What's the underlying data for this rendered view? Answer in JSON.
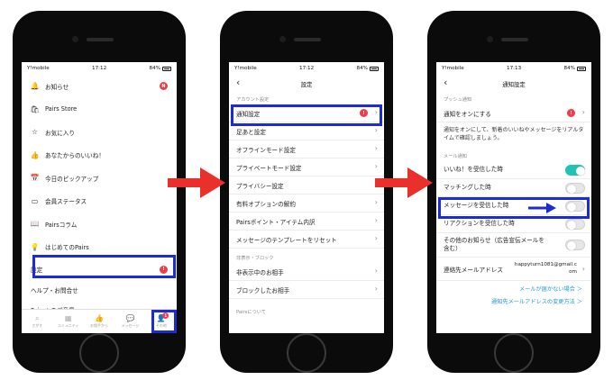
{
  "colors": {
    "accent_highlight": "#1d2bd6",
    "arrow": "#e9302a",
    "toggle_on": "#1fc4b4",
    "badge": "#ef3d49",
    "link": "#1b9ad6"
  },
  "phone1": {
    "status": {
      "carrier": "Y!mobile",
      "time": "17:12",
      "battery": "84%"
    },
    "menu": [
      {
        "icon": "bell-icon",
        "glyph": "🔔",
        "label": "お知らせ",
        "badge": "N"
      },
      {
        "icon": "store-icon",
        "glyph": "🛍",
        "label": "Pairs Store"
      },
      {
        "icon": "star-icon",
        "glyph": "☆",
        "label": "お気に入り"
      },
      {
        "icon": "thumbs-up-icon",
        "glyph": "👍",
        "label": "あなたからのいいね！"
      },
      {
        "icon": "calendar-icon",
        "glyph": "📅",
        "label": "今日のピックアップ"
      },
      {
        "icon": "card-icon",
        "glyph": "▭",
        "label": "会員ステータス"
      },
      {
        "icon": "book-icon",
        "glyph": "📖",
        "label": "Pairsコラム"
      },
      {
        "icon": "bulb-icon",
        "glyph": "💡",
        "label": "はじめてのPairs"
      }
    ],
    "settings": {
      "label": "設定",
      "badge": "!"
    },
    "extra": [
      "ヘルプ・お問合せ",
      "Pairsへのご意見"
    ],
    "tabs": [
      {
        "icon": "search-icon",
        "glyph": "⌕",
        "label": "さがす"
      },
      {
        "icon": "community-icon",
        "glyph": "▦",
        "label": "コミュニティ"
      },
      {
        "icon": "like-icon",
        "glyph": "👍",
        "label": "お相手から"
      },
      {
        "icon": "message-icon",
        "glyph": "💬",
        "label": "メッセージ"
      },
      {
        "icon": "person-icon",
        "glyph": "👤",
        "label": "その他",
        "badge": "1"
      }
    ]
  },
  "phone2": {
    "status": {
      "carrier": "Y!mobile",
      "time": "17:12",
      "battery": "84%"
    },
    "title": "設定",
    "section1": "アカウント設定",
    "rows1": [
      {
        "label": "通知設定",
        "badge": "!"
      },
      {
        "label": "足あと設定"
      },
      {
        "label": "オフラインモード設定"
      },
      {
        "label": "プライベートモード設定"
      },
      {
        "label": "プライバシー設定"
      },
      {
        "label": "有料オプションの解約"
      },
      {
        "label": "Pairsポイント・アイテム内訳"
      },
      {
        "label": "メッセージのテンプレートをリセット"
      }
    ],
    "section2": "非表示・ブロック",
    "rows2": [
      {
        "label": "非表示中のお相手"
      },
      {
        "label": "ブロックしたお相手"
      }
    ],
    "section3": "Pairsについて"
  },
  "phone3": {
    "status": {
      "carrier": "Y!mobile",
      "time": "17:13",
      "battery": "84%"
    },
    "title": "通知設定",
    "section1": "プッシュ通知",
    "push_row": {
      "label": "通知をオンにする",
      "badge": "!"
    },
    "push_desc": "通知をオンにして、新着のいいねやメッセージをリアルタイムで確認しましょう。",
    "section2": "メール通知",
    "toggles": [
      {
        "label": "いいね！を受信した時",
        "on": true
      },
      {
        "label": "マッチングした時",
        "on": false
      },
      {
        "label": "メッセージを受信した時",
        "on": false
      },
      {
        "label": "リアクションを受信した時",
        "on": false
      },
      {
        "label": "その他のお知らせ（広告宣伝メールを含む）",
        "on": false
      }
    ],
    "email_row": {
      "label": "連絡先メールアドレス",
      "value": "happyturn1081@gmail.com"
    },
    "links": [
      "メールが届かない場合 ＞",
      "通知先メールアドレスの変更方法 ＞"
    ]
  }
}
